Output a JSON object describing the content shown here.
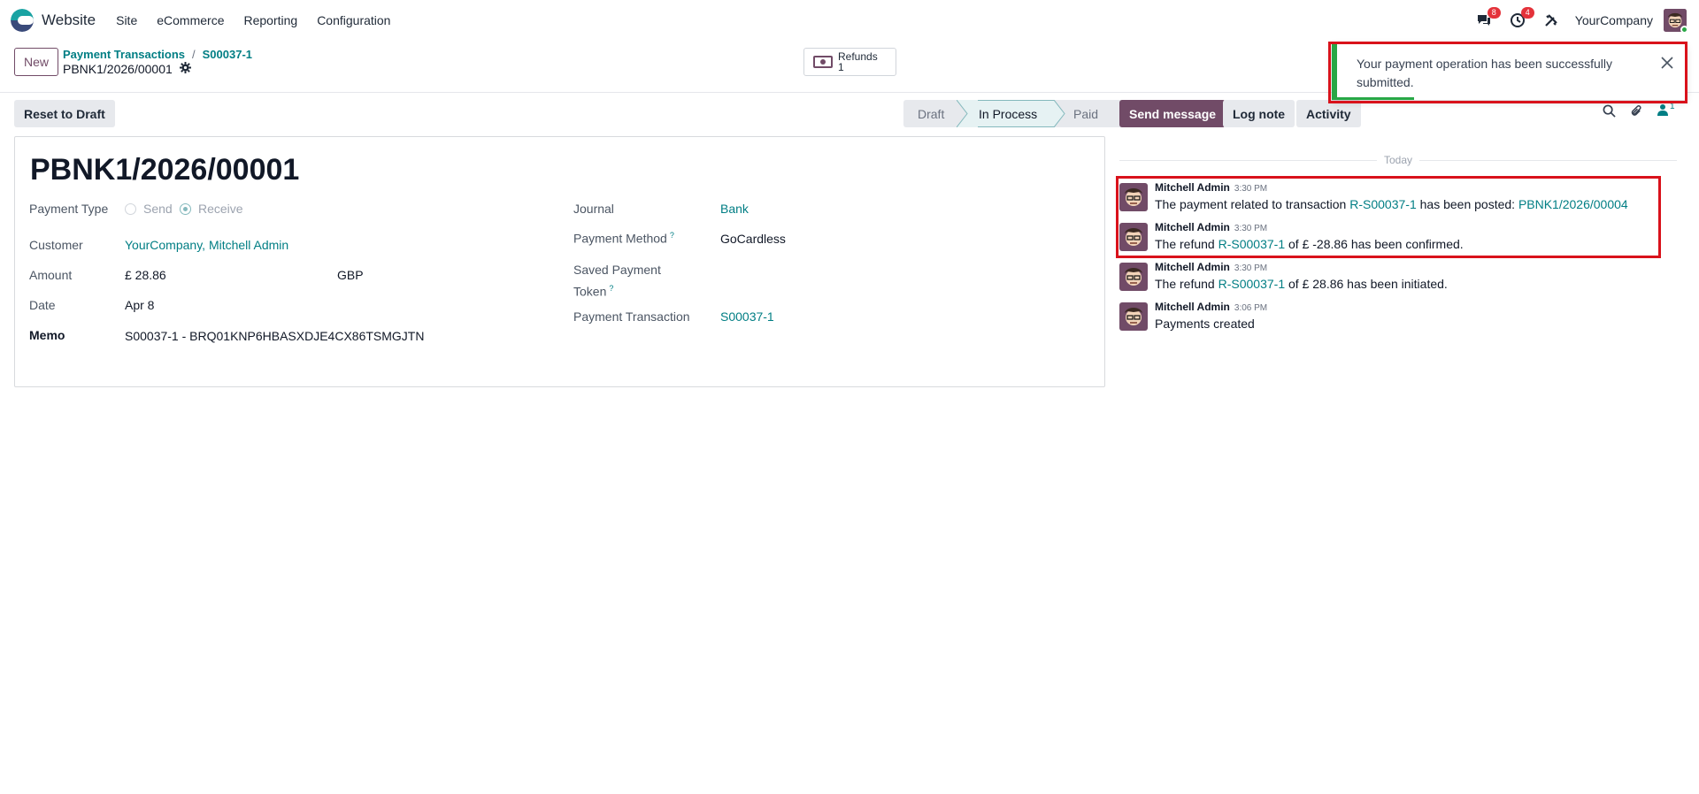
{
  "navbar": {
    "app_name": "Website",
    "menu": [
      "Site",
      "eCommerce",
      "Reporting",
      "Configuration"
    ],
    "messages_badge": "8",
    "activities_badge": "4",
    "company": "YourCompany"
  },
  "control_panel": {
    "new_label": "New",
    "breadcrumb": [
      "Payment Transactions",
      "S00037-1"
    ],
    "record_name": "PBNK1/2026/00001",
    "smart_button": {
      "label": "Refunds",
      "count": "1"
    }
  },
  "form": {
    "reset_label": "Reset to Draft",
    "stages": [
      {
        "label": "Draft",
        "active": false
      },
      {
        "label": "In Process",
        "active": true
      },
      {
        "label": "Paid",
        "active": false
      }
    ],
    "title": "PBNK1/2026/00001",
    "payment_type": {
      "label": "Payment Type",
      "options": [
        "Send",
        "Receive"
      ],
      "selected": "Receive"
    },
    "customer": {
      "label": "Customer",
      "value": "YourCompany, Mitchell Admin"
    },
    "amount": {
      "label": "Amount",
      "value": "£ 28.86",
      "currency": "GBP"
    },
    "date": {
      "label": "Date",
      "value": "Apr 8"
    },
    "memo": {
      "label": "Memo",
      "value": "S00037-1 - BRQ01KNP6HBASXDJE4CX86TSMGJTN"
    },
    "journal": {
      "label": "Journal",
      "value": "Bank"
    },
    "payment_method": {
      "label": "Payment Method",
      "help": "?",
      "value": "GoCardless"
    },
    "saved_token": {
      "label_line1": "Saved Payment",
      "label_line2": "Token",
      "help": "?"
    },
    "payment_transaction": {
      "label": "Payment Transaction",
      "value": "S00037-1"
    }
  },
  "chatter": {
    "send_message": "Send message",
    "log_note": "Log note",
    "activity": "Activity",
    "followers_count": "1",
    "date_separator": "Today",
    "messages": [
      {
        "author": "Mitchell Admin",
        "time": "3:30 PM",
        "pre": "The payment related to transaction ",
        "link1": "R-S00037-1",
        "mid": " has been posted: ",
        "link2": "PBNK1/2026/00004",
        "post": ""
      },
      {
        "author": "Mitchell Admin",
        "time": "3:30 PM",
        "pre": "The refund ",
        "link1": "R-S00037-1",
        "mid": " of £ -28.86 has been confirmed.",
        "link2": "",
        "post": ""
      },
      {
        "author": "Mitchell Admin",
        "time": "3:30 PM",
        "pre": "The refund ",
        "link1": "R-S00037-1",
        "mid": " of £ 28.86 has been initiated.",
        "link2": "",
        "post": ""
      },
      {
        "author": "Mitchell Admin",
        "time": "3:06 PM",
        "pre": "Payments created",
        "link1": "",
        "mid": "",
        "link2": "",
        "post": ""
      }
    ]
  },
  "toast": {
    "message": "Your payment operation has been successfully submitted.",
    "type_color": "#28a745",
    "progress": 0.22
  },
  "colors": {
    "primary": "#714b67",
    "link": "#017e84",
    "highlight": "#d9121b",
    "badge": "#e4323a"
  }
}
